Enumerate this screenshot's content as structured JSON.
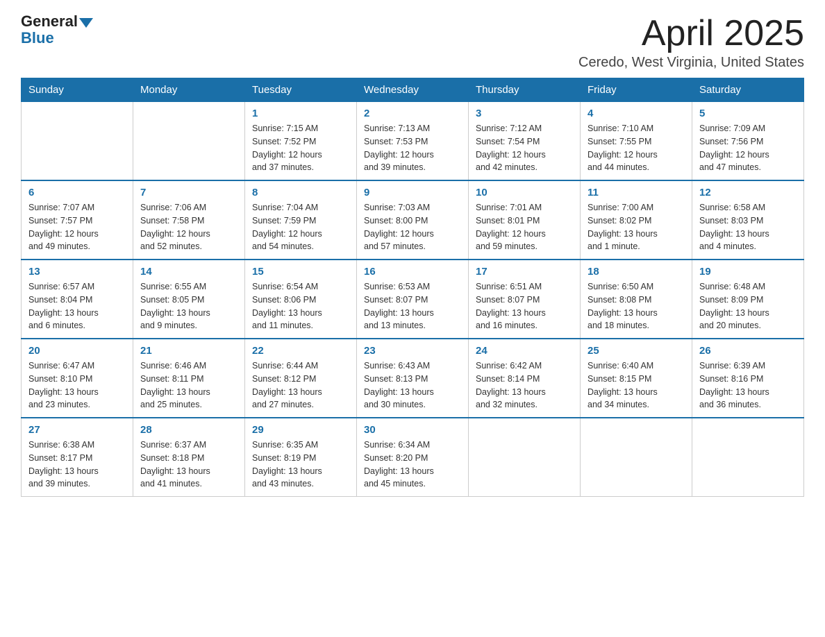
{
  "header": {
    "logo_general": "General",
    "logo_blue": "Blue",
    "month_title": "April 2025",
    "location": "Ceredo, West Virginia, United States"
  },
  "days_of_week": [
    "Sunday",
    "Monday",
    "Tuesday",
    "Wednesday",
    "Thursday",
    "Friday",
    "Saturday"
  ],
  "weeks": [
    [
      {
        "day": "",
        "info": ""
      },
      {
        "day": "",
        "info": ""
      },
      {
        "day": "1",
        "info": "Sunrise: 7:15 AM\nSunset: 7:52 PM\nDaylight: 12 hours\nand 37 minutes."
      },
      {
        "day": "2",
        "info": "Sunrise: 7:13 AM\nSunset: 7:53 PM\nDaylight: 12 hours\nand 39 minutes."
      },
      {
        "day": "3",
        "info": "Sunrise: 7:12 AM\nSunset: 7:54 PM\nDaylight: 12 hours\nand 42 minutes."
      },
      {
        "day": "4",
        "info": "Sunrise: 7:10 AM\nSunset: 7:55 PM\nDaylight: 12 hours\nand 44 minutes."
      },
      {
        "day": "5",
        "info": "Sunrise: 7:09 AM\nSunset: 7:56 PM\nDaylight: 12 hours\nand 47 minutes."
      }
    ],
    [
      {
        "day": "6",
        "info": "Sunrise: 7:07 AM\nSunset: 7:57 PM\nDaylight: 12 hours\nand 49 minutes."
      },
      {
        "day": "7",
        "info": "Sunrise: 7:06 AM\nSunset: 7:58 PM\nDaylight: 12 hours\nand 52 minutes."
      },
      {
        "day": "8",
        "info": "Sunrise: 7:04 AM\nSunset: 7:59 PM\nDaylight: 12 hours\nand 54 minutes."
      },
      {
        "day": "9",
        "info": "Sunrise: 7:03 AM\nSunset: 8:00 PM\nDaylight: 12 hours\nand 57 minutes."
      },
      {
        "day": "10",
        "info": "Sunrise: 7:01 AM\nSunset: 8:01 PM\nDaylight: 12 hours\nand 59 minutes."
      },
      {
        "day": "11",
        "info": "Sunrise: 7:00 AM\nSunset: 8:02 PM\nDaylight: 13 hours\nand 1 minute."
      },
      {
        "day": "12",
        "info": "Sunrise: 6:58 AM\nSunset: 8:03 PM\nDaylight: 13 hours\nand 4 minutes."
      }
    ],
    [
      {
        "day": "13",
        "info": "Sunrise: 6:57 AM\nSunset: 8:04 PM\nDaylight: 13 hours\nand 6 minutes."
      },
      {
        "day": "14",
        "info": "Sunrise: 6:55 AM\nSunset: 8:05 PM\nDaylight: 13 hours\nand 9 minutes."
      },
      {
        "day": "15",
        "info": "Sunrise: 6:54 AM\nSunset: 8:06 PM\nDaylight: 13 hours\nand 11 minutes."
      },
      {
        "day": "16",
        "info": "Sunrise: 6:53 AM\nSunset: 8:07 PM\nDaylight: 13 hours\nand 13 minutes."
      },
      {
        "day": "17",
        "info": "Sunrise: 6:51 AM\nSunset: 8:07 PM\nDaylight: 13 hours\nand 16 minutes."
      },
      {
        "day": "18",
        "info": "Sunrise: 6:50 AM\nSunset: 8:08 PM\nDaylight: 13 hours\nand 18 minutes."
      },
      {
        "day": "19",
        "info": "Sunrise: 6:48 AM\nSunset: 8:09 PM\nDaylight: 13 hours\nand 20 minutes."
      }
    ],
    [
      {
        "day": "20",
        "info": "Sunrise: 6:47 AM\nSunset: 8:10 PM\nDaylight: 13 hours\nand 23 minutes."
      },
      {
        "day": "21",
        "info": "Sunrise: 6:46 AM\nSunset: 8:11 PM\nDaylight: 13 hours\nand 25 minutes."
      },
      {
        "day": "22",
        "info": "Sunrise: 6:44 AM\nSunset: 8:12 PM\nDaylight: 13 hours\nand 27 minutes."
      },
      {
        "day": "23",
        "info": "Sunrise: 6:43 AM\nSunset: 8:13 PM\nDaylight: 13 hours\nand 30 minutes."
      },
      {
        "day": "24",
        "info": "Sunrise: 6:42 AM\nSunset: 8:14 PM\nDaylight: 13 hours\nand 32 minutes."
      },
      {
        "day": "25",
        "info": "Sunrise: 6:40 AM\nSunset: 8:15 PM\nDaylight: 13 hours\nand 34 minutes."
      },
      {
        "day": "26",
        "info": "Sunrise: 6:39 AM\nSunset: 8:16 PM\nDaylight: 13 hours\nand 36 minutes."
      }
    ],
    [
      {
        "day": "27",
        "info": "Sunrise: 6:38 AM\nSunset: 8:17 PM\nDaylight: 13 hours\nand 39 minutes."
      },
      {
        "day": "28",
        "info": "Sunrise: 6:37 AM\nSunset: 8:18 PM\nDaylight: 13 hours\nand 41 minutes."
      },
      {
        "day": "29",
        "info": "Sunrise: 6:35 AM\nSunset: 8:19 PM\nDaylight: 13 hours\nand 43 minutes."
      },
      {
        "day": "30",
        "info": "Sunrise: 6:34 AM\nSunset: 8:20 PM\nDaylight: 13 hours\nand 45 minutes."
      },
      {
        "day": "",
        "info": ""
      },
      {
        "day": "",
        "info": ""
      },
      {
        "day": "",
        "info": ""
      }
    ]
  ]
}
